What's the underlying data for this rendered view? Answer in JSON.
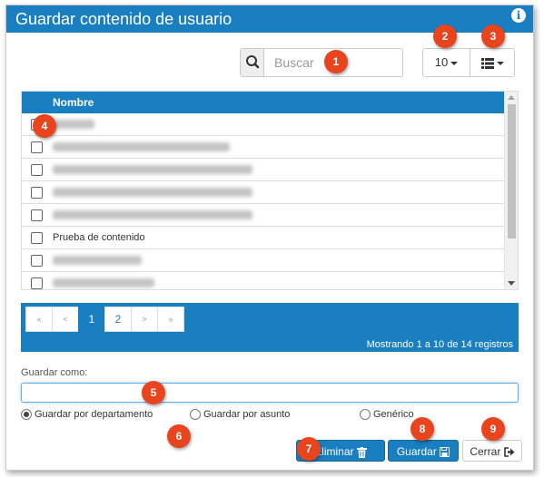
{
  "dialog": {
    "title": "Guardar contenido de usuario",
    "info_icon": "info-circle-icon"
  },
  "toolbar": {
    "search_placeholder": "Buscar",
    "search_icon": "search-icon",
    "page_size": "10",
    "columns_icon": "list-icon"
  },
  "table": {
    "header": "Nombre",
    "rows": [
      {
        "label": "",
        "redacted": true
      },
      {
        "label": "",
        "redacted": true
      },
      {
        "label": "",
        "redacted": true
      },
      {
        "label": "",
        "redacted": true
      },
      {
        "label": "",
        "redacted": true
      },
      {
        "label": "Prueba de contenido",
        "redacted": false
      },
      {
        "label": "",
        "redacted": true
      },
      {
        "label": "",
        "redacted": true
      }
    ]
  },
  "pagination": {
    "first": "«",
    "prev": "<",
    "pages": [
      "1",
      "2"
    ],
    "active_page": "1",
    "next": ">",
    "last": "»",
    "info": "Mostrando 1 a 10 de 14 registros"
  },
  "form": {
    "save_as_label": "Guardar como:",
    "save_as_value": "",
    "radio_options": [
      "Guardar por departamento",
      "Guardar por asunto",
      "Genérico"
    ],
    "selected_option": "Guardar por departamento"
  },
  "buttons": {
    "delete_label": "Eliminar",
    "save_label": "Guardar",
    "close_label": "Cerrar",
    "delete_icon": "trash-icon",
    "save_icon": "save-icon",
    "close_icon": "sign-out-icon"
  },
  "callouts": [
    "1",
    "2",
    "3",
    "4",
    "5",
    "6",
    "7",
    "8",
    "9"
  ],
  "colors": {
    "primary": "#1a7fc1",
    "callout": "#e8441e"
  }
}
